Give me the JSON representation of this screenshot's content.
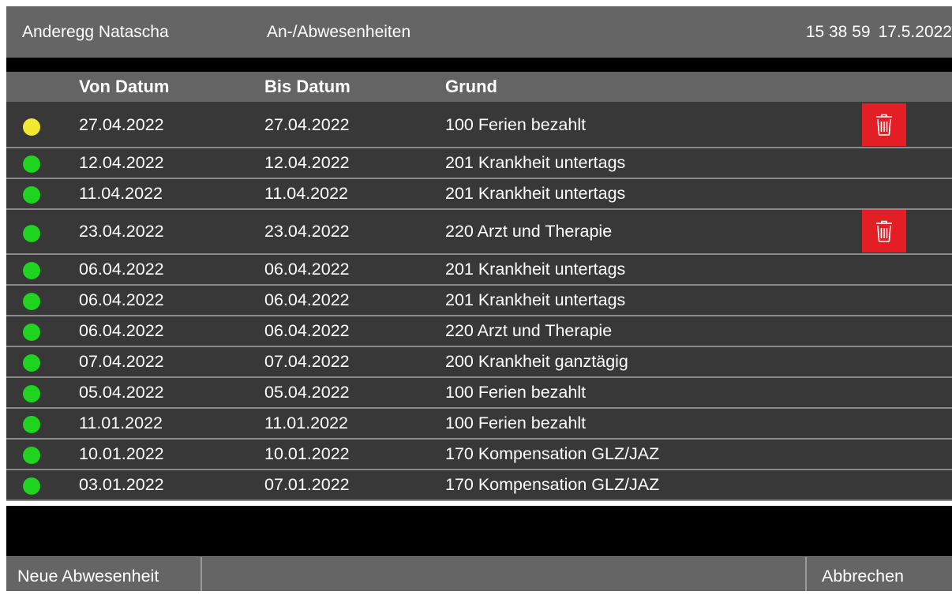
{
  "top_bar": {
    "user_name": "Anderegg Natascha",
    "title": "An-/Abwesenheiten",
    "time": "15 38 59",
    "date": "17.5.2022"
  },
  "table": {
    "columns": {
      "von": "Von Datum",
      "bis": "Bis Datum",
      "grund": "Grund"
    },
    "rows": [
      {
        "status_color": "#f2e830",
        "von": "27.04.2022",
        "bis": "27.04.2022",
        "grund": "100 Ferien bezahlt",
        "deletable": true
      },
      {
        "status_color": "#1fd41f",
        "von": "12.04.2022",
        "bis": "12.04.2022",
        "grund": "201 Krankheit untertags",
        "deletable": false
      },
      {
        "status_color": "#1fd41f",
        "von": "11.04.2022",
        "bis": "11.04.2022",
        "grund": "201 Krankheit untertags",
        "deletable": false
      },
      {
        "status_color": "#1fd41f",
        "von": "23.04.2022",
        "bis": "23.04.2022",
        "grund": "220 Arzt und Therapie",
        "deletable": true
      },
      {
        "status_color": "#1fd41f",
        "von": "06.04.2022",
        "bis": "06.04.2022",
        "grund": "201 Krankheit untertags",
        "deletable": false
      },
      {
        "status_color": "#1fd41f",
        "von": "06.04.2022",
        "bis": "06.04.2022",
        "grund": "201 Krankheit untertags",
        "deletable": false
      },
      {
        "status_color": "#1fd41f",
        "von": "06.04.2022",
        "bis": "06.04.2022",
        "grund": "220 Arzt und Therapie",
        "deletable": false
      },
      {
        "status_color": "#1fd41f",
        "von": "07.04.2022",
        "bis": "07.04.2022",
        "grund": "200 Krankheit ganztägig",
        "deletable": false
      },
      {
        "status_color": "#1fd41f",
        "von": "05.04.2022",
        "bis": "05.04.2022",
        "grund": "100 Ferien bezahlt",
        "deletable": false
      },
      {
        "status_color": "#1fd41f",
        "von": "11.01.2022",
        "bis": "11.01.2022",
        "grund": "100 Ferien bezahlt",
        "deletable": false
      },
      {
        "status_color": "#1fd41f",
        "von": "10.01.2022",
        "bis": "10.01.2022",
        "grund": "170 Kompensation GLZ/JAZ",
        "deletable": false
      },
      {
        "status_color": "#1fd41f",
        "von": "03.01.2022",
        "bis": "07.01.2022",
        "grund": "170 Kompensation GLZ/JAZ",
        "deletable": false
      }
    ],
    "delete_icon": "trash-icon"
  },
  "footer": {
    "new_label": "Neue Abwesenheit",
    "cancel_label": "Abbrechen"
  },
  "colors": {
    "bar": "#656565",
    "row": "#383838",
    "delete": "#e41e25",
    "status_pending": "#f2e830",
    "status_ok": "#1fd41f"
  }
}
